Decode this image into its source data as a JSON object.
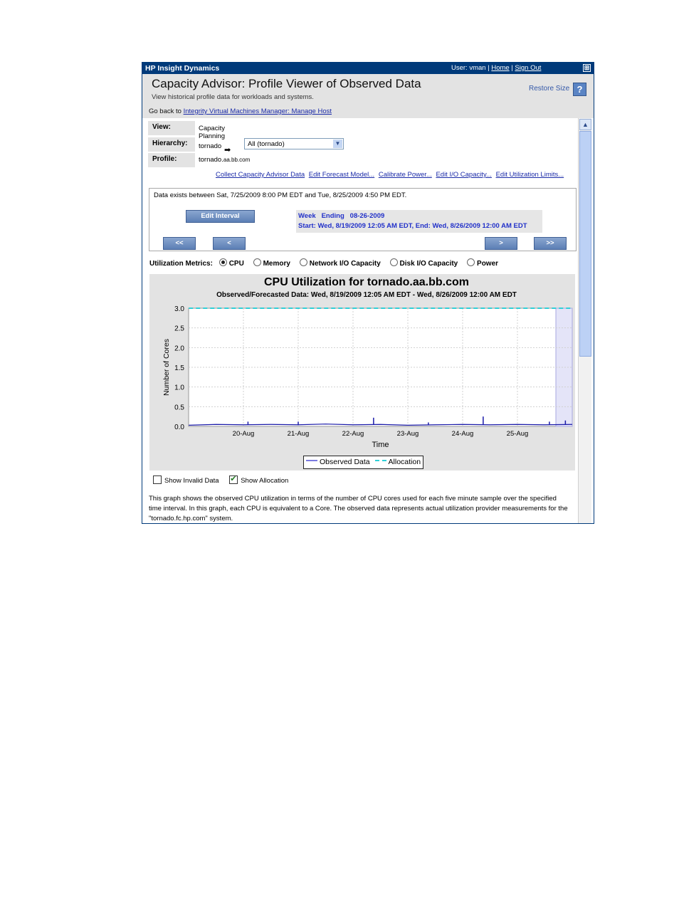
{
  "topbar": {
    "app_name": "HP Insight Dynamics",
    "user_label": "User: vman",
    "home": "Home",
    "signout": "Sign Out",
    "sep": "|",
    "max_icon": "⊞"
  },
  "header": {
    "title": "Capacity Advisor: Profile Viewer of Observed Data",
    "subtitle": "View historical profile data for workloads and systems.",
    "goback_prefix": "Go back to",
    "goback_link": "Integrity Virtual Machines Manager: Manage Host",
    "restore_size": "Restore Size",
    "help": "?"
  },
  "info": {
    "view_label": "View:",
    "view_value": "Capacity Planning",
    "hierarchy_label": "Hierarchy:",
    "hierarchy_value": "tornado",
    "hierarchy_select": "All (tornado)",
    "profile_label": "Profile:",
    "profile_host": "tornado.",
    "profile_domain": "aa.bb.com"
  },
  "links": [
    "Collect Capacity Advisor Data",
    "Edit Forecast Model...",
    "Calibrate Power...",
    "Edit I/O Capacity...",
    "Edit Utilization Limits..."
  ],
  "interval": {
    "data_exists": "Data exists between Sat, 7/25/2009 8:00 PM EDT and Tue, 8/25/2009 4:50 PM EDT.",
    "edit_button": "Edit Interval",
    "week_line": "Week   Ending   08-26-2009",
    "start_end": "Start: Wed, 8/19/2009 12:05 AM EDT, End: Wed, 8/26/2009 12:00 AM EDT",
    "nav_first": "<<",
    "nav_prev": "<",
    "nav_next": ">",
    "nav_last": ">>"
  },
  "metrics": {
    "label": "Utilization Metrics:",
    "options": [
      "CPU",
      "Memory",
      "Network I/O Capacity",
      "Disk I/O Capacity",
      "Power"
    ],
    "selected": "CPU"
  },
  "chart_data": {
    "type": "line",
    "title": "CPU Utilization for tornado.aa.bb.com",
    "subtitle": "Observed/Forecasted Data: Wed, 8/19/2009 12:05 AM EDT - Wed, 8/26/2009 12:00 AM EDT",
    "xlabel": "Time",
    "ylabel": "Number of Cores",
    "ylim": [
      0,
      3.0
    ],
    "yticks": [
      "0.0",
      "0.5",
      "1.0",
      "1.5",
      "2.0",
      "2.5",
      "3.0"
    ],
    "xticks": [
      "20-Aug",
      "21-Aug",
      "22-Aug",
      "23-Aug",
      "24-Aug",
      "25-Aug"
    ],
    "xlim_days": [
      "8/19/2009",
      "8/26/2009"
    ],
    "grid": true,
    "legend_position": "bottom-center",
    "highlight_region": [
      "8/25/2009 16:50",
      "8/26/2009 00:00"
    ],
    "series": [
      {
        "name": "Observed Data",
        "color": "#1a1aa8",
        "style": "solid",
        "x": [
          "8/19 00:05",
          "8/19 12:00",
          "8/20 00:00",
          "8/20 12:00",
          "8/21 00:00",
          "8/21 12:00",
          "8/22 00:00",
          "8/22 12:00",
          "8/23 00:00",
          "8/23 12:00",
          "8/24 00:00",
          "8/24 12:00",
          "8/25 00:00",
          "8/25 12:00",
          "8/26 00:00"
        ],
        "values": [
          0.03,
          0.05,
          0.04,
          0.05,
          0.04,
          0.06,
          0.04,
          0.05,
          0.03,
          0.04,
          0.05,
          0.04,
          0.05,
          0.04,
          0.05
        ],
        "peaks": [
          {
            "x": "8/20 02:00",
            "y": 0.12
          },
          {
            "x": "8/21 00:00",
            "y": 0.12
          },
          {
            "x": "8/22 09:00",
            "y": 0.22
          },
          {
            "x": "8/23 09:00",
            "y": 0.1
          },
          {
            "x": "8/24 09:00",
            "y": 0.25
          },
          {
            "x": "8/25 14:00",
            "y": 0.12
          },
          {
            "x": "8/25 21:00",
            "y": 0.15
          }
        ]
      },
      {
        "name": "Allocation",
        "color": "#2fd0d8",
        "style": "dashed",
        "x": [
          "8/19 00:05",
          "8/26 00:00"
        ],
        "values": [
          3.0,
          3.0
        ]
      }
    ]
  },
  "checkboxes": [
    {
      "label": "Show Invalid Data",
      "checked": false
    },
    {
      "label": "Show Allocation",
      "checked": true
    }
  ],
  "description": "This graph shows the observed CPU utilization in terms of the number of CPU cores used for each five minute sample over the specified time interval. In this graph, each CPU is equivalent to a Core. The observed data represents actual utilization provider measurements for the \"tornado.fc.hp.com\" system."
}
